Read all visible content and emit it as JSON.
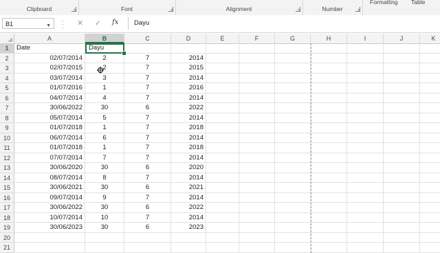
{
  "ribbon": {
    "groups": [
      {
        "label": "Clipboard",
        "launcher": true
      },
      {
        "label": "Font",
        "launcher": true
      },
      {
        "label": "Alignment",
        "launcher": true
      },
      {
        "label": "Number",
        "launcher": true
      }
    ],
    "partial_labels": [
      "Formatting",
      "Table"
    ]
  },
  "formula_bar": {
    "name_box": "B1",
    "cancel_icon": "close-icon",
    "enter_icon": "check-icon",
    "fx_label": "fx",
    "content": "Dayu"
  },
  "columns": [
    "A",
    "B",
    "C",
    "D",
    "E",
    "F",
    "G",
    "H",
    "I",
    "J",
    "K"
  ],
  "selected_column": "B",
  "selected_row": "1",
  "rows": [
    {
      "n": "1",
      "a": "Date",
      "b": "Dayu",
      "c": "",
      "d": ""
    },
    {
      "n": "2",
      "a": "02/07/2014",
      "b": "2",
      "c": "7",
      "d": "2014"
    },
    {
      "n": "3",
      "a": "02/07/2015",
      "b": "2",
      "c": "7",
      "d": "2015"
    },
    {
      "n": "4",
      "a": "03/07/2014",
      "b": "3",
      "c": "7",
      "d": "2014"
    },
    {
      "n": "5",
      "a": "01/07/2016",
      "b": "1",
      "c": "7",
      "d": "2016"
    },
    {
      "n": "6",
      "a": "04/07/2014",
      "b": "4",
      "c": "7",
      "d": "2014"
    },
    {
      "n": "7",
      "a": "30/06/2022",
      "b": "30",
      "c": "6",
      "d": "2022"
    },
    {
      "n": "8",
      "a": "05/07/2014",
      "b": "5",
      "c": "7",
      "d": "2014"
    },
    {
      "n": "9",
      "a": "01/07/2018",
      "b": "1",
      "c": "7",
      "d": "2018"
    },
    {
      "n": "10",
      "a": "06/07/2014",
      "b": "6",
      "c": "7",
      "d": "2014"
    },
    {
      "n": "11",
      "a": "01/07/2018",
      "b": "1",
      "c": "7",
      "d": "2018"
    },
    {
      "n": "12",
      "a": "07/07/2014",
      "b": "7",
      "c": "7",
      "d": "2014"
    },
    {
      "n": "13",
      "a": "30/06/2020",
      "b": "30",
      "c": "6",
      "d": "2020"
    },
    {
      "n": "14",
      "a": "08/07/2014",
      "b": "8",
      "c": "7",
      "d": "2014"
    },
    {
      "n": "15",
      "a": "30/06/2021",
      "b": "30",
      "c": "6",
      "d": "2021"
    },
    {
      "n": "16",
      "a": "09/07/2014",
      "b": "9",
      "c": "7",
      "d": "2014"
    },
    {
      "n": "17",
      "a": "30/06/2022",
      "b": "30",
      "c": "6",
      "d": "2022"
    },
    {
      "n": "18",
      "a": "10/07/2014",
      "b": "10",
      "c": "7",
      "d": "2014"
    },
    {
      "n": "19",
      "a": "30/06/2023",
      "b": "30",
      "c": "6",
      "d": "2023"
    },
    {
      "n": "20",
      "a": "",
      "b": "",
      "c": "",
      "d": ""
    },
    {
      "n": "21",
      "a": "",
      "b": "",
      "c": "",
      "d": ""
    }
  ],
  "colors": {
    "accent": "#217346",
    "header_bg": "#f3f3f3",
    "selected_header_bg": "#d2d2d2"
  }
}
